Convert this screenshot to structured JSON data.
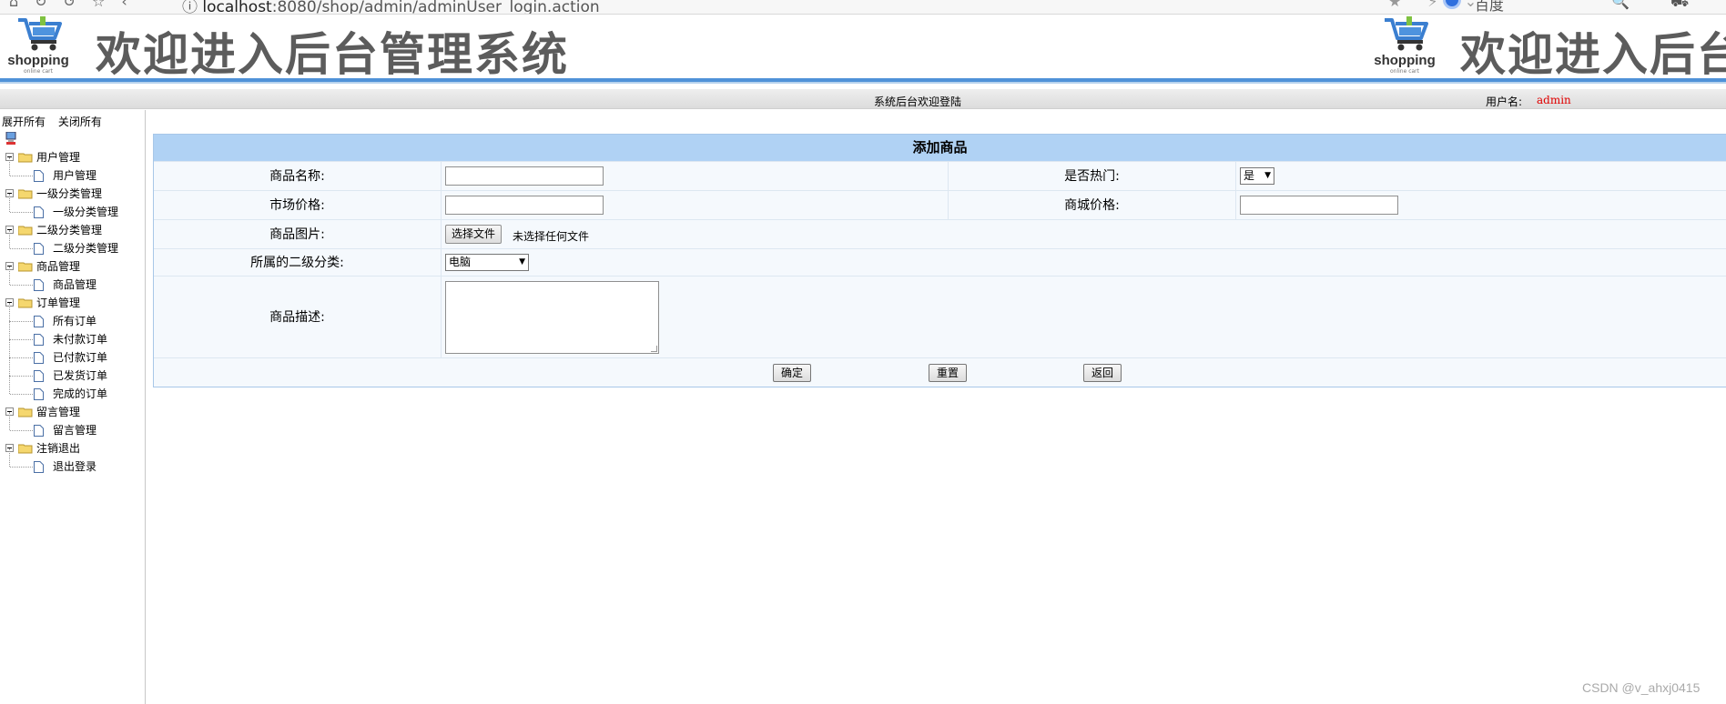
{
  "browser": {
    "url_host": "localhost",
    "url_rest": ":8080/shop/admin/adminUser_login.action",
    "search_engine": "百度"
  },
  "banner": {
    "logo_brand": "shopping",
    "logo_sub": "online cart",
    "title": "欢迎进入后台管理系统"
  },
  "status": {
    "welcome": "系统后台欢迎登陆",
    "user_label": "用户名:",
    "user_name": "admin"
  },
  "sidebar": {
    "expand_all": "展开所有",
    "collapse_all": "关闭所有",
    "groups": [
      {
        "label": "用户管理",
        "items": [
          "用户管理"
        ]
      },
      {
        "label": "一级分类管理",
        "items": [
          "一级分类管理"
        ]
      },
      {
        "label": "二级分类管理",
        "items": [
          "二级分类管理"
        ]
      },
      {
        "label": "商品管理",
        "items": [
          "商品管理"
        ]
      },
      {
        "label": "订单管理",
        "items": [
          "所有订单",
          "未付款订单",
          "已付款订单",
          "已发货订单",
          "完成的订单"
        ]
      },
      {
        "label": "留言管理",
        "items": [
          "留言管理"
        ]
      },
      {
        "label": "注销退出",
        "items": [
          "退出登录"
        ]
      }
    ]
  },
  "form": {
    "title": "添加商品",
    "name_label": "商品名称:",
    "hot_label": "是否热门:",
    "hot_value": "是",
    "market_price_label": "市场价格:",
    "shop_price_label": "商城价格:",
    "image_label": "商品图片:",
    "file_button": "选择文件",
    "file_status": "未选择任何文件",
    "category_label": "所属的二级分类:",
    "category_value": "电脑",
    "desc_label": "商品描述:",
    "submit": "确定",
    "reset": "重置",
    "back": "返回"
  },
  "watermark": "CSDN @v_ahxj0415"
}
